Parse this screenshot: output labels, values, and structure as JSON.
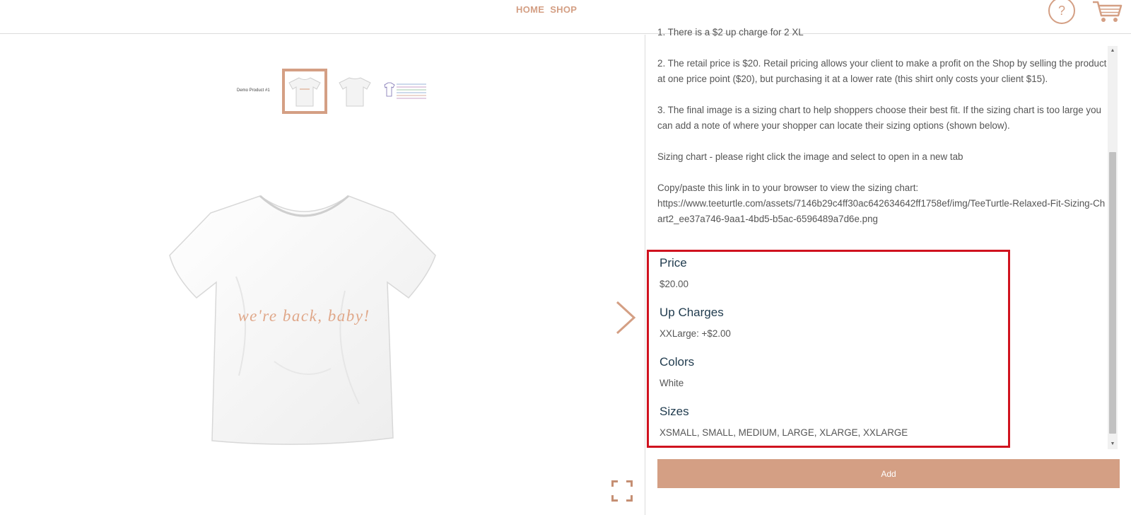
{
  "header": {
    "nav": [
      {
        "label": "HOME"
      },
      {
        "label": "SHOP"
      }
    ],
    "help_label": "?",
    "accent_color": "#d49f84"
  },
  "product": {
    "thumbnail_label": "Demo Product #1",
    "shirt_text": "we're back, baby!",
    "thumbnails": [
      "front-tshirt",
      "back-tshirt",
      "sizing-chart"
    ]
  },
  "description": {
    "cut_line": "1. There is a $2 up charge for 2 XL",
    "p2": "2. The retail price is $20. Retail pricing allows your client to make a profit on the Shop by selling the product at one price point ($20), but purchasing it at a lower rate (this shirt only costs your client $15).",
    "p3": "3. The final image is a sizing chart to help shoppers choose their best fit. If the sizing chart is too large you can add a note of where your shopper can locate their sizing options (shown below).",
    "p4": "Sizing chart - please right click the image and select to open in a new tab",
    "p5_intro": "Copy/paste this link in to your browser to view the sizing chart:",
    "p5_url": "https://www.teeturtle.com/assets/7146b29c4ff30ac642634642ff1758ef/img/TeeTurtle-Relaxed-Fit-Sizing-Chart2_ee37a746-9aa1-4bd5-b5ac-6596489a7d6e.png"
  },
  "specs": {
    "price_label": "Price",
    "price_value": "$20.00",
    "upcharges_label": "Up Charges",
    "upcharges_value": "XXLarge: +$2.00",
    "colors_label": "Colors",
    "colors_value": "White",
    "sizes_label": "Sizes",
    "sizes_value": "XSMALL, SMALL, MEDIUM, LARGE, XLARGE, XXLARGE",
    "highlight_color": "#d0131f"
  },
  "actions": {
    "add_label": "Add"
  }
}
